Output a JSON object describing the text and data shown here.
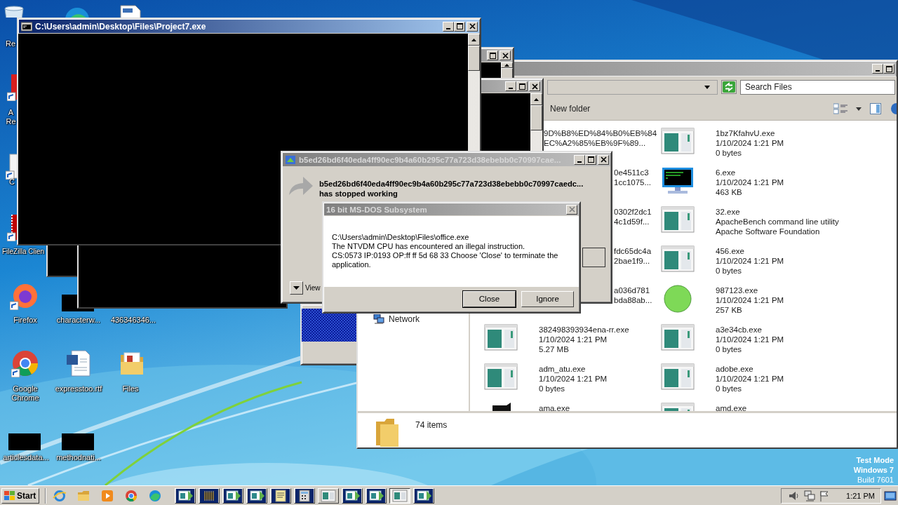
{
  "desktop_icons": [
    {
      "kind": "recycle",
      "label": "Re"
    },
    {
      "kind": "edge"
    },
    {
      "kind": "document"
    },
    {
      "kind": "acrobat",
      "label": "A Re"
    },
    {
      "kind": "blank-shortcut",
      "label": "C"
    },
    {
      "kind": "filezilla",
      "label": "FileZilla Clien"
    },
    {
      "kind": "firefox",
      "label": "Firefox"
    },
    {
      "kind": "black",
      "label": "characterw..."
    },
    {
      "kind": "none",
      "label": "436346346..."
    },
    {
      "kind": "chrome",
      "label": "Google Chrome"
    },
    {
      "kind": "word",
      "label": "expresstoo.rtf"
    },
    {
      "kind": "folder",
      "label": "Files"
    },
    {
      "kind": "black",
      "label": "articlesdata..."
    },
    {
      "kind": "black",
      "label": "methodnati..."
    }
  ],
  "background_windows": [
    {
      "kind": "console"
    },
    {
      "kind": "console"
    },
    {
      "kind": "console"
    },
    {
      "kind": "console"
    },
    {
      "kind": "panel"
    }
  ],
  "console_window": {
    "title": "C:\\Users\\admin\\Desktop\\Files\\Project7.exe"
  },
  "explorer": {
    "search": {
      "placeholder": "Search Files"
    },
    "new_folder": "New folder",
    "nav": [
      {
        "label": "Network"
      }
    ],
    "files_left": [
      {
        "kind": "partial",
        "lines": [
          "9D%B8%ED%84%B0%EB%84",
          "EC%A2%85%EB%9F%89..."
        ]
      },
      {
        "kind": "partial",
        "lines": [
          "0e4511c3",
          "1cc1075..."
        ]
      },
      {
        "kind": "partial",
        "lines": [
          "0302f2dc1",
          "4c1d59f..."
        ]
      },
      {
        "kind": "partial",
        "lines": [
          "fdc65dc4a",
          "2bae1f9..."
        ]
      },
      {
        "kind": "partial",
        "lines": [
          "a036d781",
          "bda88ab..."
        ]
      },
      {
        "kind": "exe",
        "lines": [
          "382498393934ena-rr.exe",
          "1/10/2024 1:21 PM",
          "5.27 MB"
        ]
      },
      {
        "kind": "exe",
        "lines": [
          "adm_atu.exe",
          "1/10/2024 1:21 PM",
          "0 bytes"
        ]
      },
      {
        "kind": "black",
        "lines": [
          "ama.exe"
        ]
      }
    ],
    "files_right": [
      {
        "kind": "exe",
        "lines": [
          "1bz7KfahvU.exe",
          "1/10/2024 1:21 PM",
          "0 bytes"
        ]
      },
      {
        "kind": "console",
        "lines": [
          "6.exe",
          "1/10/2024 1:21 PM",
          "463 KB"
        ]
      },
      {
        "kind": "exe",
        "lines": [
          "32.exe",
          "ApacheBench command line utility",
          "Apache Software Foundation"
        ]
      },
      {
        "kind": "exe",
        "lines": [
          "456.exe",
          "1/10/2024 1:21 PM",
          "0 bytes"
        ]
      },
      {
        "kind": "orb",
        "lines": [
          "987123.exe",
          "1/10/2024 1:21 PM",
          "257 KB"
        ]
      },
      {
        "kind": "exe",
        "lines": [
          "a3e34cb.exe",
          "1/10/2024 1:21 PM",
          "0 bytes"
        ]
      },
      {
        "kind": "exe",
        "lines": [
          "adobe.exe",
          "1/10/2024 1:21 PM",
          "0 bytes"
        ]
      },
      {
        "kind": "exe",
        "lines": [
          "amd.exe"
        ]
      }
    ],
    "status": "74 items"
  },
  "crash_dialog": {
    "title": "b5ed26bd6f40eda4ff90ec9b4a60b295c77a723d38ebebb0c70997cae...",
    "heading": "b5ed26bd6f40eda4ff90ec9b4a60b295c77a723d38ebebb0c70997caedc...",
    "subheading": "has stopped working",
    "details": "View"
  },
  "dos_dialog": {
    "title": "16 bit MS-DOS Subsystem",
    "message": [
      "C:\\Users\\admin\\Desktop\\Files\\office.exe",
      "The NTVDM CPU has encountered an illegal instruction.",
      "CS:0573 IP:0193 OP:ff ff 5d 68 33 Choose 'Close' to terminate the application."
    ],
    "buttons": [
      {
        "label": "Close",
        "default": true
      },
      {
        "label": "Ignore",
        "default": false
      }
    ]
  },
  "taskbar": {
    "start": "Start",
    "quick_launch": [
      {
        "kind": "ie"
      },
      {
        "kind": "explorer"
      },
      {
        "kind": "media"
      },
      {
        "kind": "chrome"
      },
      {
        "kind": "edge"
      }
    ],
    "tasks": [
      {
        "kind": "app",
        "selected": false
      },
      {
        "kind": "chip",
        "selected": false
      },
      {
        "kind": "app",
        "selected": false
      },
      {
        "kind": "app",
        "selected": false
      },
      {
        "kind": "doc",
        "selected": false
      },
      {
        "kind": "calc",
        "selected": false
      },
      {
        "kind": "window",
        "selected": false
      },
      {
        "kind": "app",
        "selected": false
      },
      {
        "kind": "app",
        "selected": false
      },
      {
        "kind": "window",
        "selected": true
      },
      {
        "kind": "app",
        "selected": false
      }
    ],
    "clock": "1:21 PM"
  },
  "os_notice": [
    "Test Mode",
    "Windows 7",
    "Build 7601"
  ]
}
